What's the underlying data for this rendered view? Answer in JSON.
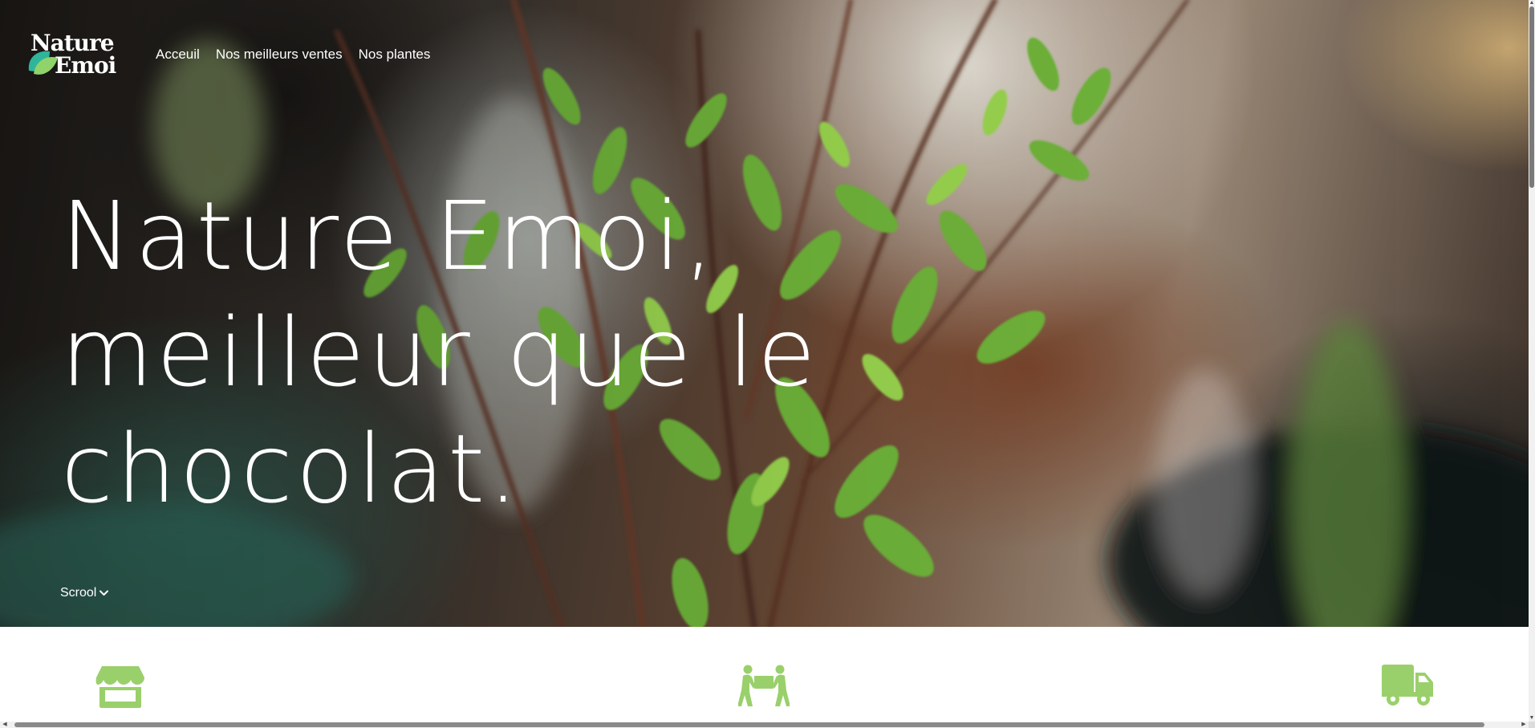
{
  "nav": {
    "logo_line1": "Nature",
    "logo_line2": "Emoi",
    "links": [
      "Acceuil",
      "Nos meilleurs ventes",
      "Nos plantes"
    ]
  },
  "hero": {
    "headline_lines": [
      "Nature Emoi,",
      "meilleur que le",
      "chocolat."
    ],
    "scroll_label": "Scrool",
    "scroll_icon": "chevron-down-icon"
  },
  "features": {
    "icons": [
      "store-icon",
      "people-carry-icon",
      "truck-icon"
    ],
    "accent_color": "#9ad06b"
  },
  "colors": {
    "accent": "#9ad06b",
    "logo_leaf_light": "#8fd36a",
    "logo_leaf_dark": "#2fb59a",
    "text_on_hero": "#ffffff"
  }
}
